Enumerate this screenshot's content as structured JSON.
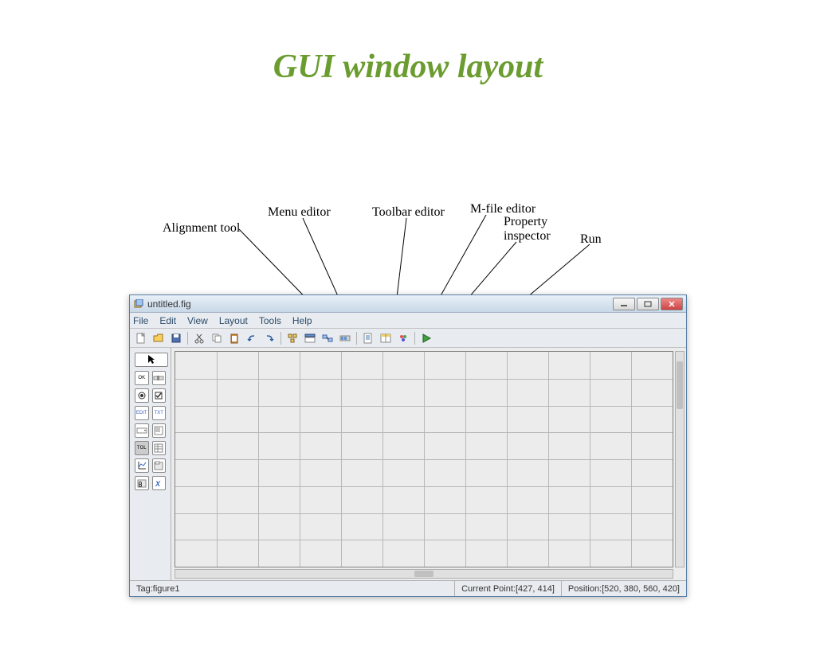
{
  "slide": {
    "title": "GUI window layout"
  },
  "annotations": {
    "alignment": "Alignment tool",
    "menu_editor": "Menu editor",
    "toolbar_editor": "Toolbar editor",
    "mfile_editor": "M-file editor",
    "property_inspector": "Property\ninspector",
    "run": "Run"
  },
  "titlebar": {
    "text": "untitled.fig"
  },
  "menubar": {
    "items": [
      "File",
      "Edit",
      "View",
      "Layout",
      "Tools",
      "Help"
    ]
  },
  "status": {
    "tag_label": "Tag: ",
    "tag_value": "figure1",
    "point_label": "Current Point:  ",
    "point_value": "[427, 414]",
    "pos_label": "Position: ",
    "pos_value": "[520, 380, 560, 420]"
  },
  "toolbar_icons": [
    "new-icon",
    "open-icon",
    "save-icon",
    "sep",
    "cut-icon",
    "copy-icon",
    "paste-icon",
    "undo-icon",
    "redo-icon",
    "sep",
    "align-icon",
    "menu-editor-icon",
    "tab-order-icon",
    "toolbar-editor-icon",
    "sep",
    "mfile-editor-icon",
    "property-inspector-icon",
    "object-browser-icon",
    "sep",
    "run-icon"
  ],
  "palette": {
    "arrow": "select-arrow",
    "rows": [
      [
        "push-button-icon",
        "slider-icon"
      ],
      [
        "radio-button-icon",
        "checkbox-icon"
      ],
      [
        "edit-text-icon",
        "static-text-icon"
      ],
      [
        "popup-menu-icon",
        "listbox-icon"
      ],
      [
        "toggle-button-icon",
        "table-icon"
      ],
      [
        "axes-icon",
        "panel-icon"
      ],
      [
        "button-group-icon",
        "activex-icon"
      ]
    ]
  }
}
